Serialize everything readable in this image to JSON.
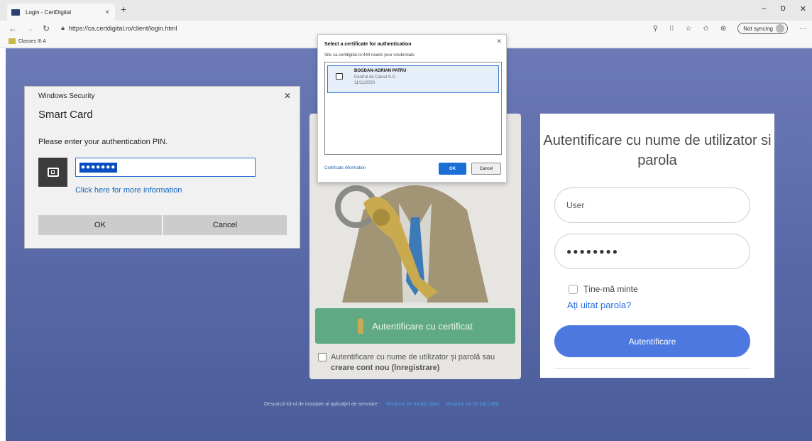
{
  "browser": {
    "tab_title": "Login - CertDigital",
    "tab_close": "×",
    "new_tab": "+",
    "url": "https://ca.certdigital.ro/client/login.html",
    "sync_label": "Not syncing",
    "bookmark": "Classes III A",
    "min": "–",
    "max": "ס",
    "close": "✕"
  },
  "winsec": {
    "title": "Windows Security",
    "heading": "Smart Card",
    "prompt": "Please enter your authentication PIN.",
    "pin_value": "●●●●●●●",
    "more_info": "Click here for more information",
    "ok": "OK",
    "cancel": "Cancel"
  },
  "cert_dialog": {
    "title": "Select a certificate for authentication",
    "subtitle": "Site ca.certdigital.ro:444 needs your credentials:",
    "cert_name": "BOGDAN-ADRIAN PATRU",
    "cert_org": "Centrul de Calcul S.A.",
    "cert_date": "11/11/2020",
    "info_link": "Certificate information",
    "ok": "OK",
    "cancel": "Cancel"
  },
  "page": {
    "cert_button": "Autentificare cu certificat",
    "alt_text": "Autentificare cu nume de utilizator și parolă sau",
    "alt_bold": "creare cont nou (înregistrare)",
    "login_title": "Autentificare cu nume de utilizator si parola",
    "user_placeholder": "User",
    "password_value": "●●●●●●●●",
    "remember": "Ține-mă minte",
    "forgot": "Ați uitat parola?",
    "auth_button": "Autentificare",
    "footer_text": "Descarcă kit-ul de instalare al aplicaţiei de semnare :",
    "footer_link_64": "Versiune pe 64 biţi (x64)",
    "footer_link_32": "Versiune pe 32 biţi (x86)"
  },
  "colors": {
    "page_bg": "#5a6aa8",
    "cert_button": "#5fa984",
    "auth_button": "#4d78e0",
    "link": "#2a6fe0"
  }
}
